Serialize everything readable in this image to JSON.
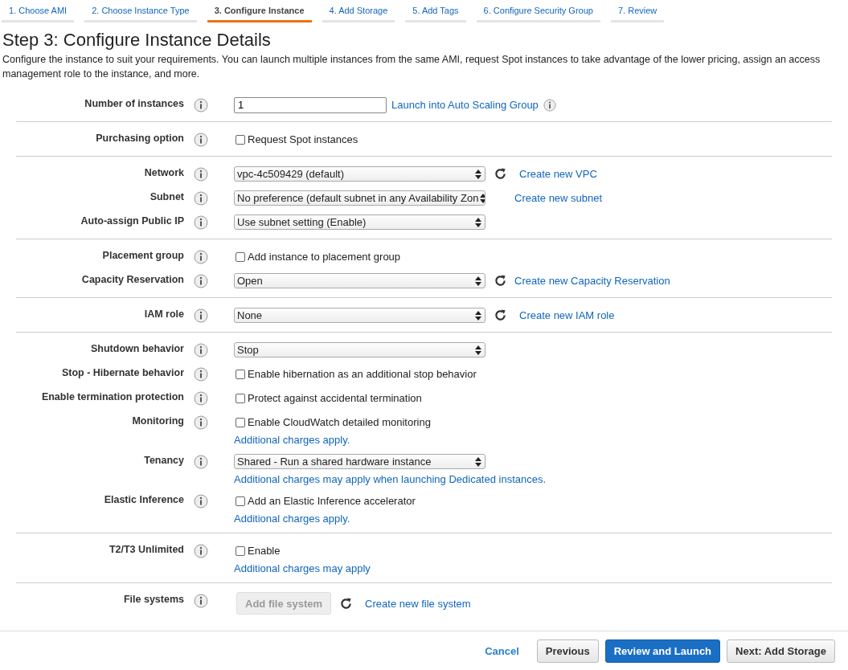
{
  "steps": [
    {
      "label": "1. Choose AMI",
      "selected": false
    },
    {
      "label": "2. Choose Instance Type",
      "selected": false
    },
    {
      "label": "3. Configure Instance",
      "selected": true
    },
    {
      "label": "4. Add Storage",
      "selected": false
    },
    {
      "label": "5. Add Tags",
      "selected": false
    },
    {
      "label": "6. Configure Security Group",
      "selected": false
    },
    {
      "label": "7. Review",
      "selected": false
    }
  ],
  "heading": "Step 3: Configure Instance Details",
  "description": "Configure the instance to suit your requirements. You can launch multiple instances from the same AMI, request Spot instances to take advantage of the lower pricing, assign an access management role to the instance, and more.",
  "sections": [
    {
      "rows": [
        {
          "label": "Number of instances",
          "kind": "text",
          "value": "1",
          "link": "Launch into Auto Scaling Group",
          "link_info": true
        }
      ]
    },
    {
      "rows": [
        {
          "label": "Purchasing option",
          "kind": "checkbox",
          "text": "Request Spot instances",
          "checked": false
        }
      ]
    },
    {
      "rows": [
        {
          "label": "Network",
          "kind": "select",
          "value": "vpc-4c509429 (default)",
          "refresh": true,
          "link": "Create new VPC"
        },
        {
          "label": "Subnet",
          "kind": "select",
          "value": "No preference (default subnet in any Availability Zon",
          "link": "Create new subnet"
        },
        {
          "label": "Auto-assign Public IP",
          "kind": "select",
          "value": "Use subnet setting (Enable)"
        }
      ]
    },
    {
      "rows": [
        {
          "label": "Placement group",
          "kind": "checkbox",
          "text": "Add instance to placement group",
          "checked": false
        },
        {
          "label": "Capacity Reservation",
          "kind": "select",
          "value": "Open",
          "refresh": true,
          "link": "Create new Capacity Reservation"
        }
      ]
    },
    {
      "rows": [
        {
          "label": "IAM role",
          "kind": "select",
          "value": "None",
          "refresh": true,
          "link": "Create new IAM role"
        }
      ]
    },
    {
      "rows": [
        {
          "label": "Shutdown behavior",
          "kind": "select",
          "value": "Stop"
        },
        {
          "label": "Stop - Hibernate behavior",
          "kind": "checkbox",
          "text": "Enable hibernation as an additional stop behavior",
          "checked": false
        },
        {
          "label": "Enable termination protection",
          "kind": "checkbox",
          "text": "Protect against accidental termination",
          "checked": false
        },
        {
          "label": "Monitoring",
          "kind": "checkbox",
          "text": "Enable CloudWatch detailed monitoring",
          "checked": false,
          "note": "Additional charges apply."
        },
        {
          "label": "Tenancy",
          "kind": "select",
          "value": "Shared - Run a shared hardware instance",
          "note": "Additional charges may apply when launching Dedicated instances."
        },
        {
          "label": "Elastic Inference",
          "kind": "checkbox",
          "text": "Add an Elastic Inference accelerator",
          "checked": false,
          "note": "Additional charges apply."
        }
      ]
    },
    {
      "rows": [
        {
          "label": "T2/T3 Unlimited",
          "kind": "checkbox",
          "text": "Enable",
          "checked": false,
          "note": "Additional charges may apply"
        }
      ]
    },
    {
      "rows": [
        {
          "label": "File systems",
          "kind": "button",
          "text": "Add file system",
          "disabled": true,
          "refresh": true,
          "link": "Create new file system"
        }
      ]
    }
  ],
  "footer": {
    "cancel": "Cancel",
    "buttons": [
      {
        "label": "Previous",
        "kind": "secondary"
      },
      {
        "label": "Review and Launch",
        "kind": "primary"
      },
      {
        "label": "Next: Add Storage",
        "kind": "secondary"
      }
    ]
  }
}
